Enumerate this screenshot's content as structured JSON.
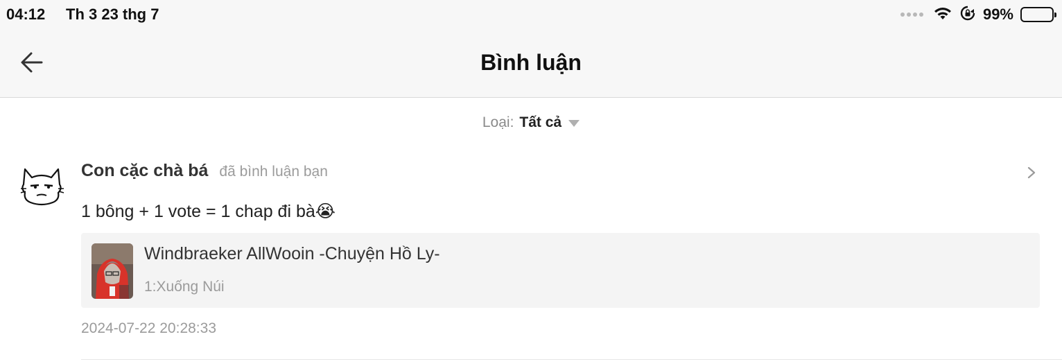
{
  "status_bar": {
    "time": "04:12",
    "date": "Th 3 23 thg 7",
    "battery_percent": "99%",
    "icons": [
      "signal-dots-icon",
      "wifi-icon",
      "rotation-lock-icon",
      "battery-icon"
    ]
  },
  "nav": {
    "title": "Bình luận",
    "back_icon": "arrow-left-icon"
  },
  "filter": {
    "label": "Loại:",
    "value": "Tất cả",
    "caret_icon": "caret-down-icon"
  },
  "comment": {
    "user_name": "Con cặc chà bá",
    "action": "đã bình luận bạn",
    "text": "1 bông + 1 vote = 1 chap đi bà",
    "emoji": "😭",
    "reference": {
      "title": "Windbraeker AllWooin -Chuyện Hồ Ly-",
      "chapter": "1:Xuống Núi"
    },
    "timestamp": "2024-07-22 20:28:33"
  },
  "colors": {
    "header_bg": "#f7f7f7",
    "muted_text": "#9b9b9b",
    "card_bg": "#f4f4f4"
  }
}
